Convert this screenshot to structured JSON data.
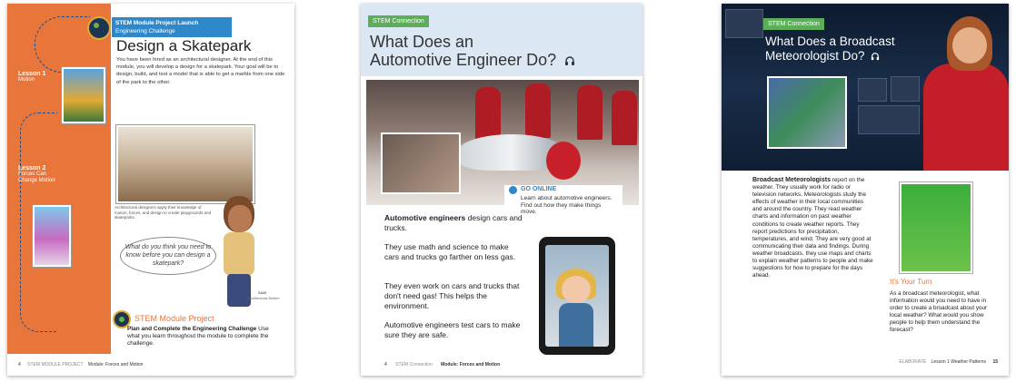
{
  "page1": {
    "banner_line1": "STEM Module Project Launch",
    "banner_line2": "Engineering Challenge",
    "title": "Design a Skatepark",
    "intro": "You have been hired as an architectural designer. At the end of this module, you will develop a design for a skatepark. Your goal will be to design, build, and test a model that is able to get a marble from one side of the park to the other.",
    "lesson1_num": "Lesson 1",
    "lesson1_name": "Motion",
    "lesson2_num": "Lesson 2",
    "lesson2_name": "Forces Can Change Motion",
    "photo_caption": "Architectural designers apply their knowledge of motion, forces, and design to create playgrounds and skateparks.",
    "bubble": "What do you think you need to know before you can design a skatepark?",
    "character_name": "SAM",
    "character_role": "Architectural Builder",
    "project_title": "STEM Module Project",
    "plan_bold": "Plan and Complete the Engineering Challenge",
    "plan_rest": " Use what you learn throughout the module to complete the challenge.",
    "footer_num": "4",
    "footer_section": "STEM MODULE PROJECT",
    "footer_module": "Module: Forces and Motion"
  },
  "page2": {
    "tag": "STEM Connection",
    "title_line1": "What Does an",
    "title_line2": "Automotive Engineer Do?",
    "go_online": "GO ONLINE",
    "go_text": "Learn about automotive engineers. Find out how they make things move.",
    "p1_bold": "Automotive engineers",
    "p1_rest": " design cars and trucks.",
    "p2": "They use math and science to make cars and trucks go farther on less gas.",
    "p3": "They even work on cars and trucks that don't need gas! This helps the environment.",
    "p4": "Automotive engineers test cars to make sure they are safe.",
    "footer_num": "4",
    "footer_section": "STEM Connection",
    "footer_module": "Module: Forces and Motion"
  },
  "page3": {
    "tag": "STEM Connection",
    "title_line1": "What Does a Broadcast",
    "title_line2": "Meteorologist Do?",
    "body_bold": "Broadcast Meteorologists",
    "body_rest": " report on the weather. They usually work for radio or television networks. Meteorologists study the effects of weather in their local communities and around the country. They read weather charts and information on past weather conditions to create weather reports. They report predictions for precipitation, temperatures, and wind. They are very good at communicating their data and findings. During weather broadcasts, they use maps and charts to explain weather patterns to people and make suggestions for how to prepare for the days ahead.",
    "your_turn": "It's Your Turn",
    "your_turn_text": "As a broadcast meteorologist, what information would you need to have in order to create a broadcast about your local weather? What would you show people to help them understand the forecast?",
    "footer_section": "ELABORATE",
    "footer_lesson": "Lesson 1 Weather Patterns",
    "footer_num": "15"
  }
}
